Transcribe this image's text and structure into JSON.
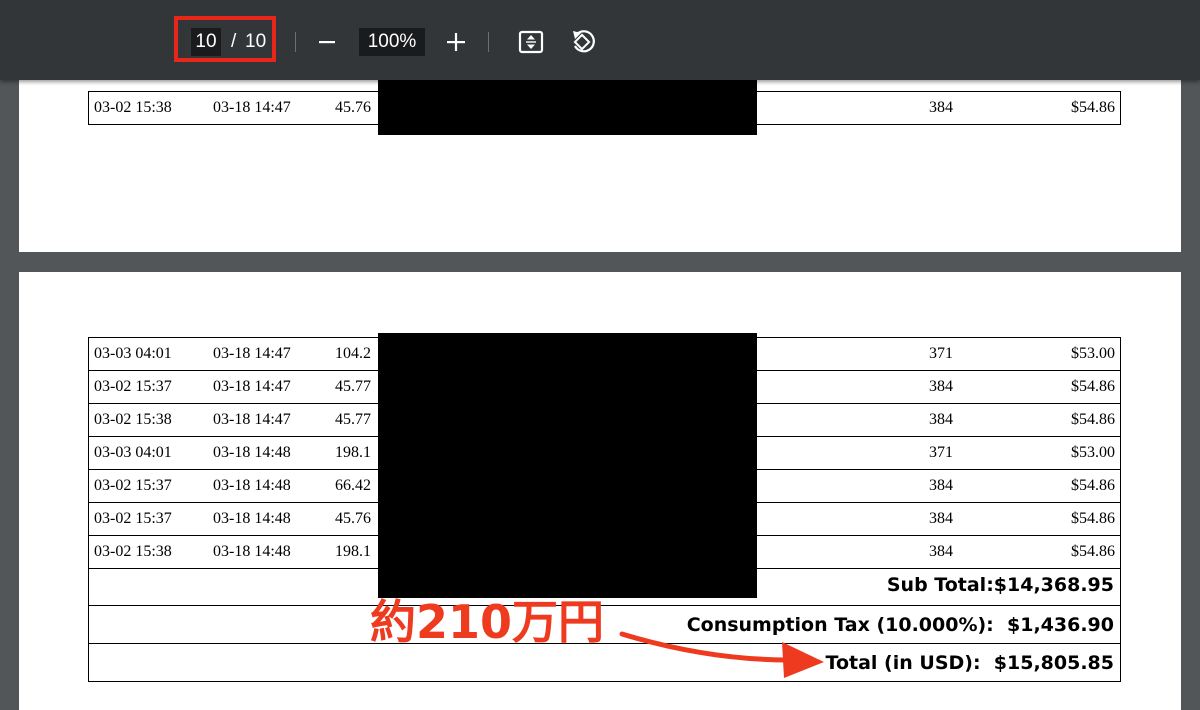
{
  "toolbar": {
    "current_page": "10",
    "page_separator": "/",
    "total_pages": "10",
    "zoom_out_icon": "minus-icon",
    "zoom_level": "100%",
    "zoom_in_icon": "plus-icon",
    "fit_icon": "fit-page-icon",
    "rotate_icon": "rotate-icon",
    "highlight_color": "#e8271a"
  },
  "page9": {
    "rows": [
      {
        "start": "03-02 15:38",
        "end": "03-18 14:47",
        "value": "45.76",
        "qty": "384",
        "amount": "$54.86"
      }
    ]
  },
  "page10": {
    "rows": [
      {
        "start": "03-03 04:01",
        "end": "03-18 14:47",
        "value": "104.2",
        "qty": "371",
        "amount": "$53.00"
      },
      {
        "start": "03-02 15:37",
        "end": "03-18 14:47",
        "value": "45.77",
        "qty": "384",
        "amount": "$54.86"
      },
      {
        "start": "03-02 15:38",
        "end": "03-18 14:47",
        "value": "45.77",
        "qty": "384",
        "amount": "$54.86"
      },
      {
        "start": "03-03 04:01",
        "end": "03-18 14:48",
        "value": "198.1",
        "qty": "371",
        "amount": "$53.00"
      },
      {
        "start": "03-02 15:37",
        "end": "03-18 14:48",
        "value": "66.42",
        "qty": "384",
        "amount": "$54.86"
      },
      {
        "start": "03-02 15:37",
        "end": "03-18 14:48",
        "value": "45.76",
        "qty": "384",
        "amount": "$54.86"
      },
      {
        "start": "03-02 15:38",
        "end": "03-18 14:48",
        "value": "198.1",
        "qty": "384",
        "amount": "$54.86"
      }
    ],
    "subtotal_label": "Sub Total:",
    "subtotal_value": "$14,368.95",
    "tax_label": "Consumption Tax (10.000%):",
    "tax_value": "$1,436.90",
    "total_label": "Total (in USD):",
    "total_value": "$15,805.85"
  },
  "annotation": {
    "text": "約210万円",
    "color": "#ee3a1f"
  }
}
